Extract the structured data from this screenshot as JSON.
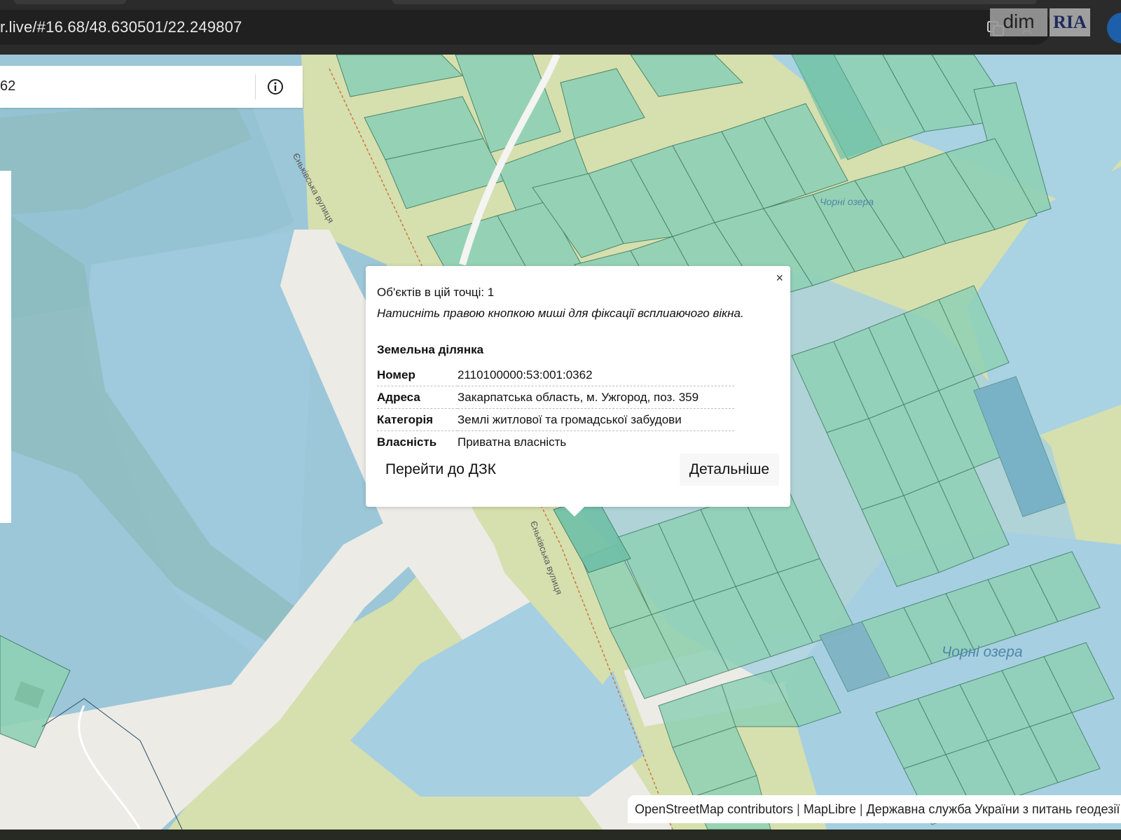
{
  "browser": {
    "url": "r.live/#16.68/48.630501/22.249807",
    "logo_dim": "dim",
    "logo_ria": "RIA"
  },
  "search": {
    "value": "62"
  },
  "map_labels": {
    "lake_upper": "Чорні озера",
    "lake_lower": "Чорні озера",
    "street_upper": "Єньківська вулиця",
    "street_lower": "Єньківська вулиця"
  },
  "popup": {
    "close": "×",
    "count": "Об'єктів в цій точці: 1",
    "hint": "Натисніть правою кнопкою миші для фіксації всплиаючого вікна.",
    "section_title": "Земельна ділянка",
    "rows": [
      {
        "key": "Номер",
        "value": "2110100000:53:001:0362"
      },
      {
        "key": "Адреса",
        "value": "Закарпатська область, м. Ужгород, поз. 359"
      },
      {
        "key": "Категорія",
        "value": "Землі житлової та громадської забудови"
      },
      {
        "key": "Власність",
        "value": "Приватна власність"
      }
    ],
    "btn_dzk": "Перейти до ДЗК",
    "btn_details": "Детальніше"
  },
  "attribution": {
    "osm": "OpenStreetMap contributors",
    "maplibre": "MapLibre",
    "agency": "Державна служба України з питань геодезії, картографії та кадастру",
    "separator": "|"
  },
  "colors": {
    "water": "#9cc7d9",
    "deep_water": "#8cbfd4",
    "parcel_green": "#8fd1b6",
    "parcel_stroke": "#3f7c62",
    "vegetation": "#d6dfae",
    "road": "#ecebe6",
    "overlay_blue": "#7fb7cf"
  }
}
